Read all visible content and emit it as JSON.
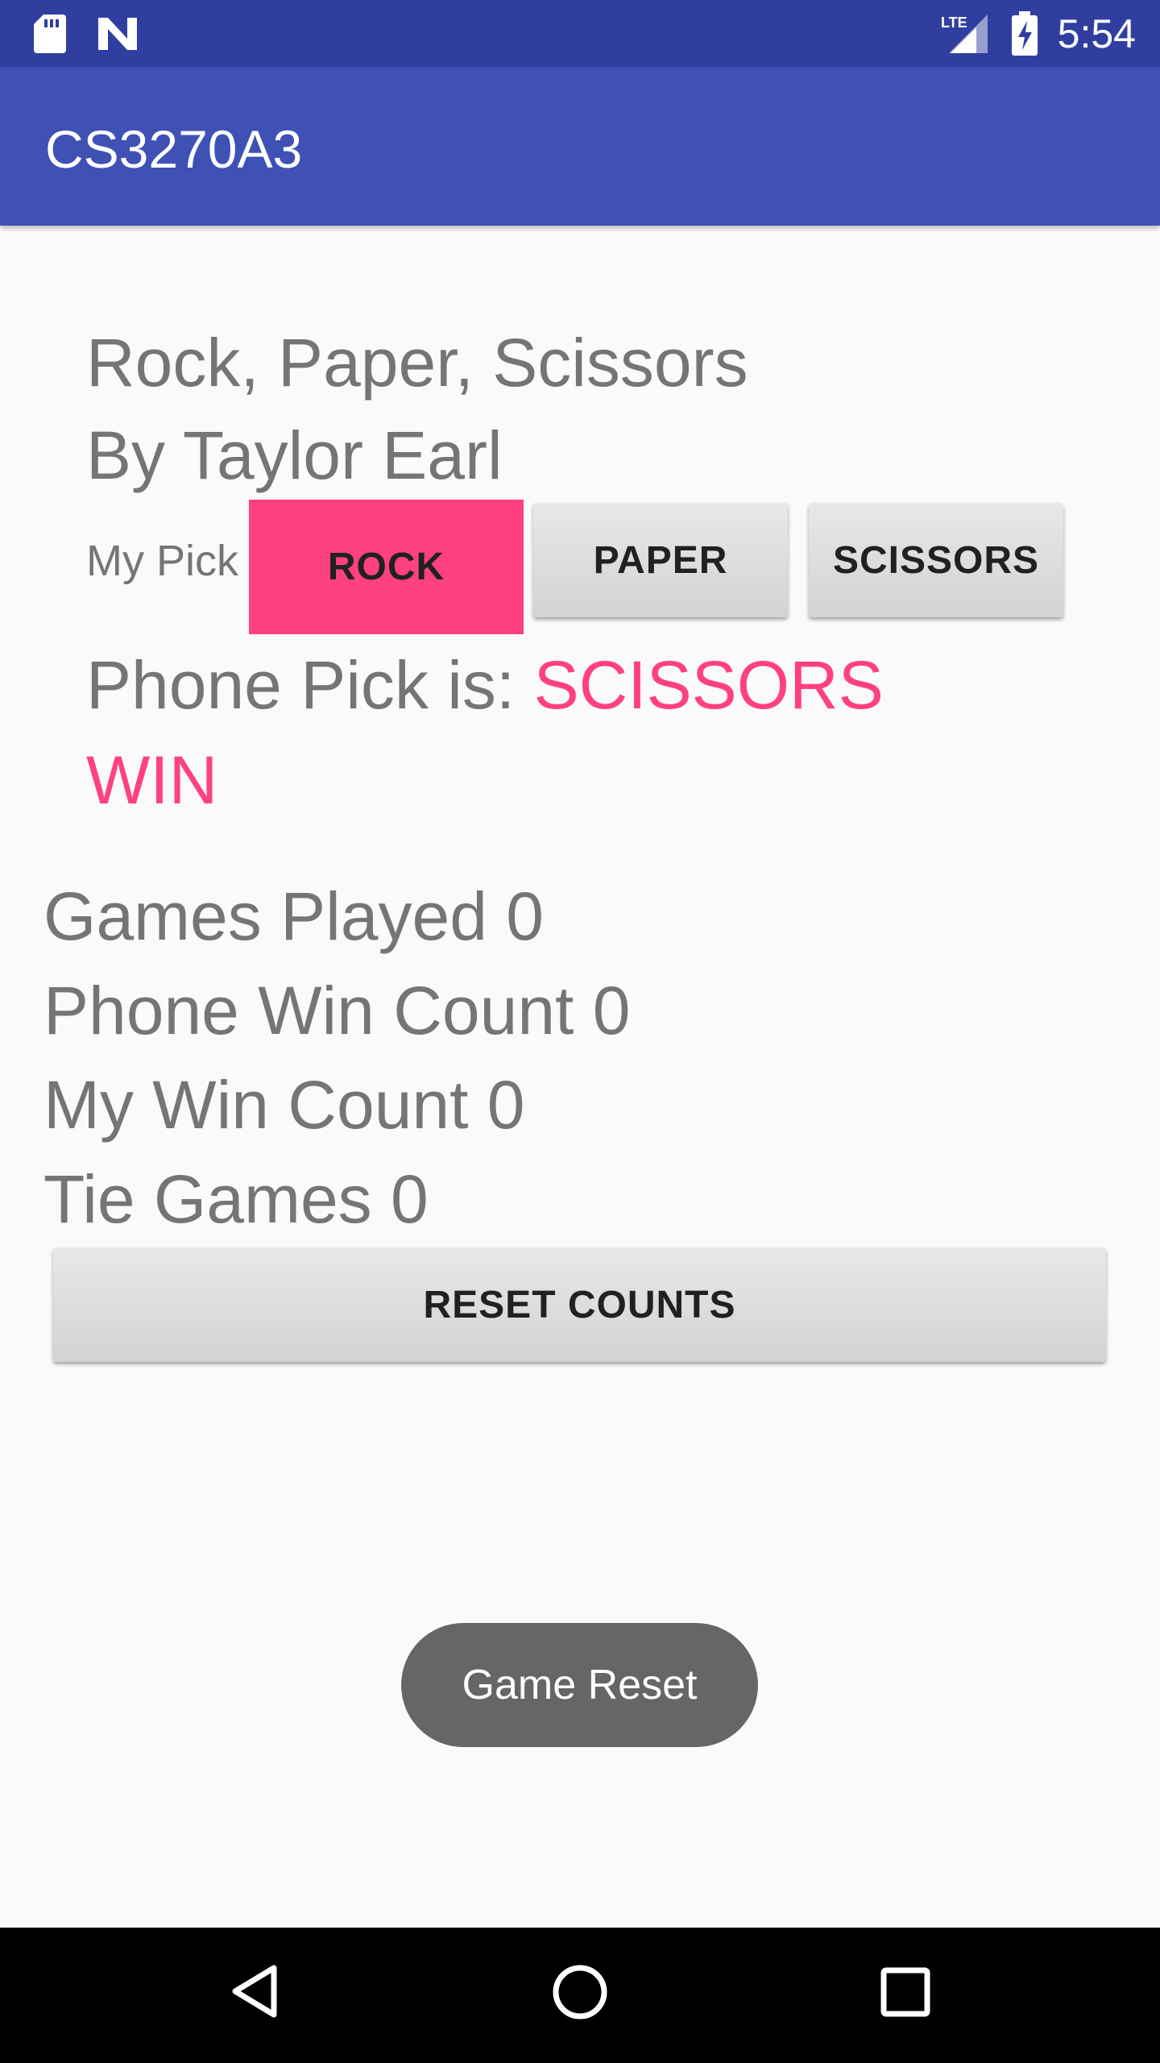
{
  "status_bar": {
    "time": "5:54",
    "network": "LTE",
    "icons": [
      "sd-card-icon",
      "n-logo-icon",
      "signal-icon",
      "battery-charging-icon"
    ]
  },
  "app_bar": {
    "title": "CS3270A3"
  },
  "header": {
    "title": "Rock, Paper, Scissors",
    "author": "By Taylor Earl"
  },
  "pick": {
    "label": "My Pick",
    "options": [
      {
        "label": "ROCK",
        "selected": true
      },
      {
        "label": "PAPER",
        "selected": false
      },
      {
        "label": "SCISSORS",
        "selected": false
      }
    ]
  },
  "result": {
    "phone_pick_label": "Phone Pick is:",
    "phone_pick_value": "SCISSORS",
    "outcome": "WIN"
  },
  "stats": {
    "games_played": "Games Played 0",
    "phone_win_count": "Phone Win Count 0",
    "my_win_count": "My Win Count 0",
    "tie_games": "Tie Games 0"
  },
  "reset_button": {
    "label": "RESET COUNTS"
  },
  "toast": {
    "message": "Game Reset"
  },
  "nav_bar": {
    "icons": [
      "back-icon",
      "home-icon",
      "recents-icon"
    ]
  },
  "colors": {
    "status_bar": "#303f9f",
    "app_bar": "#3f51b5",
    "accent": "#ff4081",
    "text_secondary": "#757575"
  }
}
